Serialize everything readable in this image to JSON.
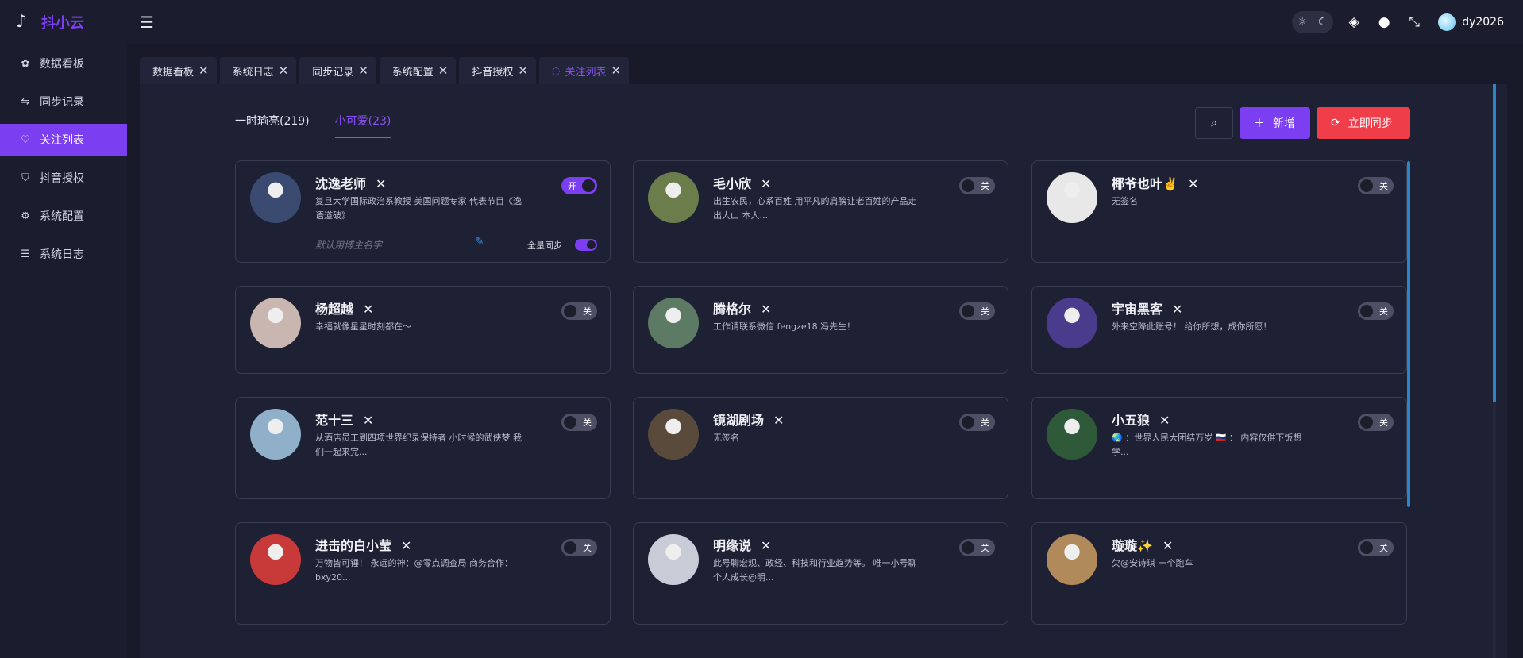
{
  "app": {
    "name": "抖小云"
  },
  "sidebar": {
    "items": [
      {
        "label": "数据看板",
        "icon": "dashboard-icon",
        "glyph": "✿"
      },
      {
        "label": "同步记录",
        "icon": "sync-arrows-icon",
        "glyph": "⇋"
      },
      {
        "label": "关注列表",
        "icon": "heart-icon",
        "glyph": "♡",
        "active": true
      },
      {
        "label": "抖音授权",
        "icon": "shield-icon",
        "glyph": "⛉"
      },
      {
        "label": "系统配置",
        "icon": "gear-icon",
        "glyph": "⚙"
      },
      {
        "label": "系统日志",
        "icon": "list-icon",
        "glyph": "☰"
      }
    ]
  },
  "header": {
    "user": "dy2026"
  },
  "tabs": [
    {
      "label": "数据看板"
    },
    {
      "label": "系统日志"
    },
    {
      "label": "同步记录"
    },
    {
      "label": "系统配置"
    },
    {
      "label": "抖音授权"
    },
    {
      "label": "关注列表",
      "active": true
    }
  ],
  "groups": [
    {
      "label": "一时瑜亮(219)"
    },
    {
      "label": "小可爱(23)",
      "active": true
    }
  ],
  "actions": {
    "add_label": "新增",
    "sync_label": "立即同步"
  },
  "cards": [
    {
      "name": "沈逸老师",
      "desc": "复旦大学国际政治系教授 美国问题专家 代表节目《逸语道破》",
      "toggle": "开",
      "on": true,
      "alias_placeholder": "默认用博主名字",
      "full_sync_label": "全量同步",
      "avatar_color": "#3a4a70"
    },
    {
      "name": "毛小欣",
      "desc": "出生农民，心系百姓 用平凡的肩膀让老百姓的产品走出大山 本人...",
      "toggle": "关",
      "avatar_color": "#6b7d4a"
    },
    {
      "name": "椰爷也叶✌️",
      "desc": "无签名",
      "toggle": "关",
      "avatar_color": "#e8e8e8"
    },
    {
      "name": "杨超越",
      "desc": "幸福就像星星时刻都在～",
      "toggle": "关",
      "avatar_color": "#c9b6b0"
    },
    {
      "name": "腾格尔",
      "desc": "工作请联系微信 fengze18 冯先生！",
      "toggle": "关",
      "avatar_color": "#5d7a64"
    },
    {
      "name": "宇宙黑客",
      "desc": "外来空降此账号！ 给你所想，成你所愿！",
      "toggle": "关",
      "avatar_color": "#4a3b8c"
    },
    {
      "name": "范十三",
      "desc": "从酒店员工到四项世界纪录保持者 小时候的武侠梦 我们一起来完...",
      "toggle": "关",
      "avatar_color": "#8fb0c8"
    },
    {
      "name": "镜湖剧场",
      "desc": "无签名",
      "toggle": "关",
      "avatar_color": "#5a4a3c"
    },
    {
      "name": "小五狼",
      "desc": "🌏 ：世界人民大团结万岁 🇷🇺 ： 内容仅供下饭想学...",
      "toggle": "关",
      "avatar_color": "#2e5a3a"
    },
    {
      "name": "进击的白小莹",
      "desc": "万物皆可锤！ 永远的神：@零点调查局 商务合作：bxy20...",
      "toggle": "关",
      "avatar_color": "#c83a3a"
    },
    {
      "name": "明缘说",
      "desc": "此号聊宏观、政经、科技和行业趋势等。 唯一小号聊个人成长@明...",
      "toggle": "关",
      "avatar_color": "#c8ccd6"
    },
    {
      "name": "璇璇✨",
      "desc": "欠@安诗琪 一个跑车",
      "toggle": "关",
      "avatar_color": "#b08a5a"
    }
  ]
}
